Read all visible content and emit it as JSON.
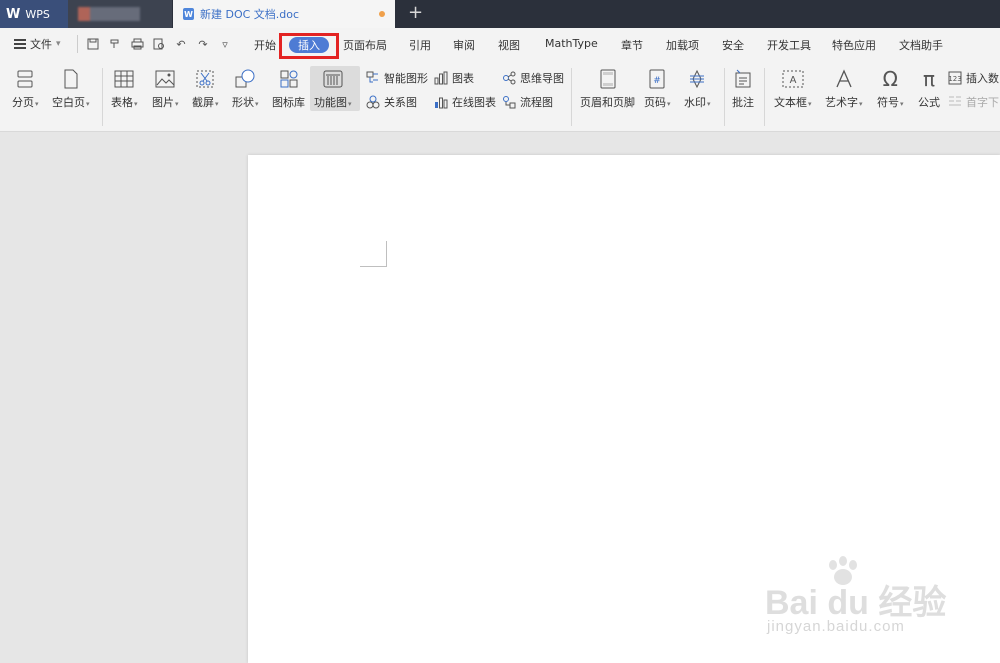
{
  "tabs": {
    "wps": "WPS",
    "doc_title": "新建 DOC 文档.doc",
    "doc_icon": "W"
  },
  "menu": {
    "file": "文件",
    "items": [
      "开始",
      "插入",
      "页面布局",
      "引用",
      "审阅",
      "视图",
      "MathType",
      "章节",
      "加载项",
      "安全",
      "开发工具",
      "特色应用",
      "文档助手"
    ]
  },
  "ribbon": {
    "page_break": "分页",
    "blank_page": "空白页",
    "table": "表格",
    "picture": "图片",
    "screenshot": "截屏",
    "shapes": "形状",
    "icon_lib": "图标库",
    "function_chart": "功能图",
    "smart_shape": "智能图形",
    "relation": "关系图",
    "chart": "图表",
    "online_chart": "在线图表",
    "mind_map": "思维导图",
    "flowchart": "流程图",
    "header_footer": "页眉和页脚",
    "page_number": "页码",
    "watermark": "水印",
    "comment": "批注",
    "textbox": "文本框",
    "wordart": "艺术字",
    "symbol": "符号",
    "formula": "公式",
    "insert_number": "插入数",
    "drop_cap": "首字下"
  },
  "watermark": {
    "brand": "Bai du 经验",
    "site": "jingyan.baidu.com"
  },
  "colors": {
    "accent": "#4e7bd4",
    "highlight_border": "#e32322",
    "titlebar": "#2b303b"
  }
}
